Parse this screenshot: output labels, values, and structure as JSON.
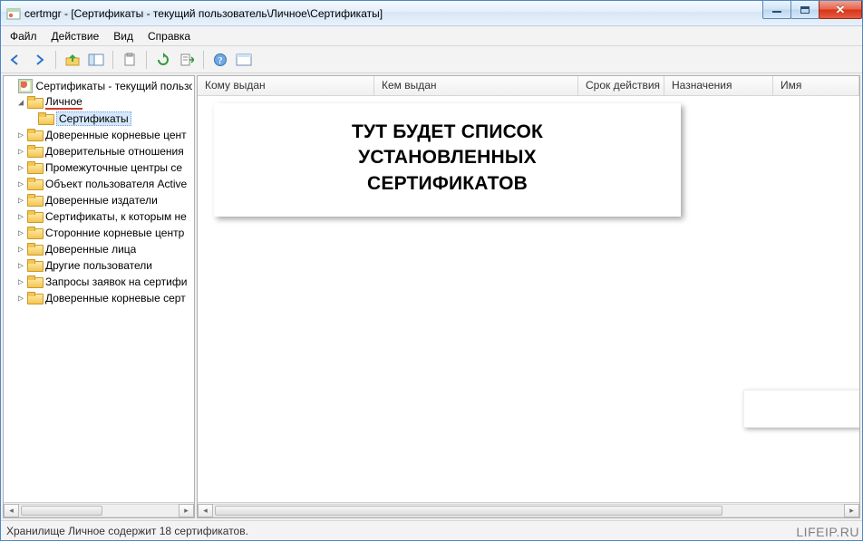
{
  "window": {
    "title": "certmgr - [Сертификаты - текущий пользователь\\Личное\\Сертификаты]"
  },
  "menu": {
    "file": "Файл",
    "action": "Действие",
    "view": "Вид",
    "help": "Справка"
  },
  "toolbar_icons": {
    "back": "back-arrow",
    "forward": "forward-arrow",
    "up": "up-folder",
    "show_hide_tree": "tree-toggle",
    "copy": "copy",
    "refresh": "refresh",
    "export": "export-list",
    "help": "help",
    "properties": "properties"
  },
  "tree": {
    "root": "Сертификаты - текущий пользователь",
    "root_display": "Сертификаты - текущий пользо",
    "personal": "Личное",
    "personal_child": "Сертификаты",
    "items": [
      "Доверенные корневые центры сертификации",
      "Доверительные отношения в предприятии",
      "Промежуточные центры сертификации",
      "Объект пользователя Active Directory",
      "Доверенные издатели",
      "Сертификаты, к которым нет доверия",
      "Сторонние корневые центры сертификации",
      "Доверенные лица",
      "Другие пользователи",
      "Запросы заявок на сертификат",
      "Доверенные корневые сертификаты смарт-карты"
    ],
    "items_display": [
      "Доверенные корневые цент",
      "Доверительные отношения",
      "Промежуточные центры се",
      "Объект пользователя Active",
      "Доверенные издатели",
      "Сертификаты, к которым не",
      "Сторонние корневые центр",
      "Доверенные лица",
      "Другие пользователи",
      "Запросы заявок на сертифи",
      "Доверенные корневые серт"
    ]
  },
  "columns": {
    "c0": "Кому выдан",
    "c1": "Кем выдан",
    "c2": "Срок действия",
    "c3": "Назначения",
    "c4": "Имя"
  },
  "overlay": {
    "line1": "ТУТ БУДЕТ СПИСОК",
    "line2": "УСТАНОВЛЕННЫХ",
    "line3": "СЕРТИФИКАТОВ"
  },
  "status": "Хранилище Личное содержит 18 сертификатов.",
  "watermark": "LIFEIP.RU",
  "colors": {
    "accent": "#d5e8fb",
    "red_underline": "#d63b25"
  }
}
